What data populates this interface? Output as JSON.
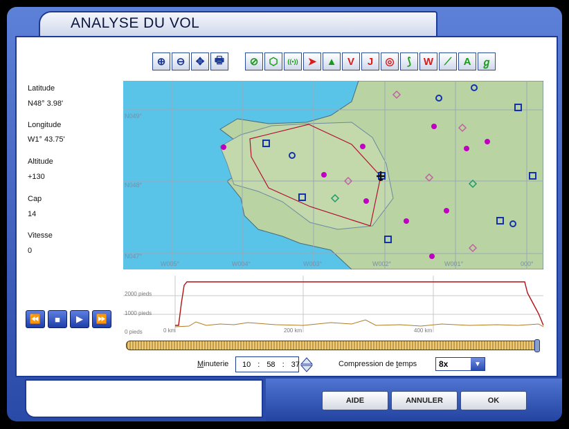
{
  "window": {
    "title": "ANALYSE DU VOL"
  },
  "map_tools": [
    {
      "name": "zoom-in-icon",
      "glyph": "⊕",
      "color": "#1d3a94"
    },
    {
      "name": "zoom-out-icon",
      "glyph": "⊖",
      "color": "#1d3a94"
    },
    {
      "name": "pan-icon",
      "glyph": "✥",
      "color": "#1d3a94"
    },
    {
      "name": "print-icon",
      "glyph": "🖶",
      "color": "#1d3a94"
    }
  ],
  "layer_tools": [
    {
      "name": "airport-icon",
      "glyph": "⊘",
      "color": "#1a9a1a"
    },
    {
      "name": "vor-icon",
      "glyph": "⬡",
      "color": "#1a9a1a"
    },
    {
      "name": "ndb-icon",
      "glyph": "((•))",
      "color": "#1a9a1a"
    },
    {
      "name": "flight-path-icon",
      "glyph": "➤",
      "color": "#d81c1c"
    },
    {
      "name": "terrain-icon",
      "glyph": "▲",
      "color": "#1a9a1a"
    },
    {
      "name": "v-icon",
      "glyph": "V",
      "color": "#d81c1c"
    },
    {
      "name": "j-icon",
      "glyph": "J",
      "color": "#d81c1c"
    },
    {
      "name": "airspace-icon",
      "glyph": "◎",
      "color": "#d81c1c"
    },
    {
      "name": "route-icon",
      "glyph": "⟆",
      "color": "#1a9a1a"
    },
    {
      "name": "w-icon",
      "glyph": "W",
      "color": "#d81c1c"
    },
    {
      "name": "airway-icon",
      "glyph": "⟋",
      "color": "#1a9a1a"
    },
    {
      "name": "label-icon",
      "glyph": "A",
      "color": "#1a9a1a"
    },
    {
      "name": "coastline-icon",
      "glyph": "ℊ",
      "color": "#1a9a1a"
    }
  ],
  "info": {
    "latitude_label": "Latitude",
    "latitude_value": "N48° 3.98'",
    "longitude_label": "Longitude",
    "longitude_value": "W1° 43.75'",
    "altitude_label": "Altitude",
    "altitude_value": "+130",
    "heading_label": "Cap",
    "heading_value": "14",
    "speed_label": "Vitesse",
    "speed_value": "0"
  },
  "map": {
    "lat_labels": [
      "N049°",
      "N048°",
      "N047°"
    ],
    "lon_labels": [
      "W005°",
      "W004°",
      "W003°",
      "W002°",
      "W001°",
      "000°"
    ]
  },
  "profile": {
    "alt_labels": [
      "2000 pieds",
      "1000 pieds",
      "0 pieds"
    ],
    "dist_labels": [
      "0 km",
      "200 km",
      "400 km"
    ]
  },
  "playback": {
    "rewind": "⏪",
    "stop": "■",
    "play": "▶",
    "forward": "⏩",
    "position": 1.0
  },
  "timer": {
    "label_prefix": "M",
    "label_rest": "inuterie",
    "h": "10",
    "m": "58",
    "s": "37",
    "sep": ":"
  },
  "compression": {
    "label_start": "Compression de ",
    "label_u": "t",
    "label_end": "emps",
    "value": "8x",
    "arrow": "▼"
  },
  "buttons": {
    "help": "AIDE",
    "cancel": "ANNULER",
    "ok": "OK"
  }
}
